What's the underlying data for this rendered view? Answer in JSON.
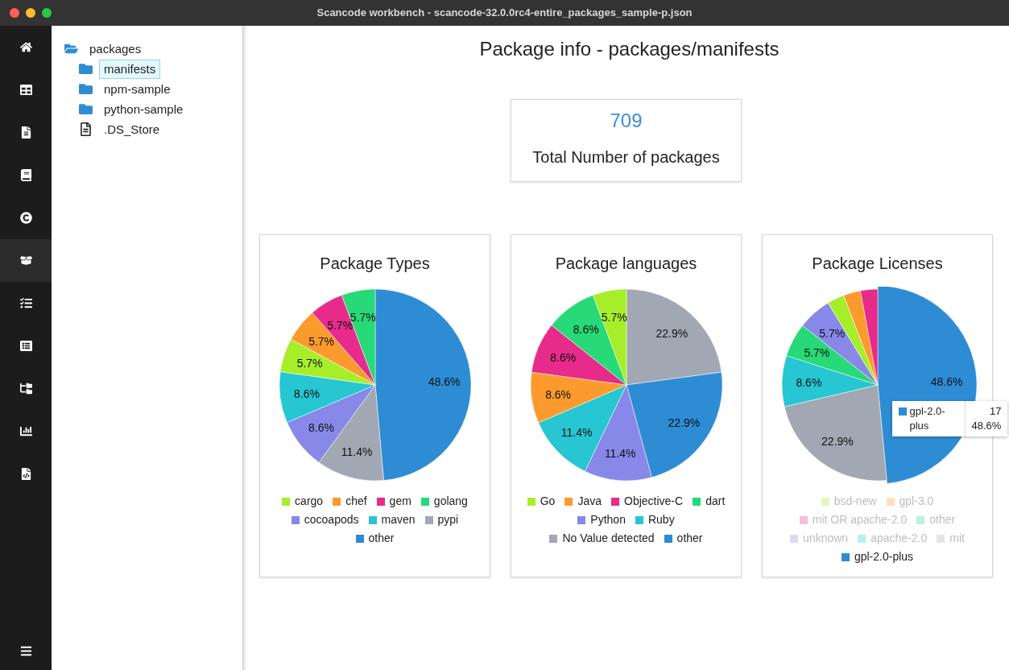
{
  "window": {
    "title": "Scancode workbench - scancode-32.0.0rc4-entire_packages_sample-p.json"
  },
  "sidebar": {
    "items": [
      {
        "selected": false
      },
      {
        "selected": false
      },
      {
        "selected": false
      },
      {
        "selected": false
      },
      {
        "selected": false
      },
      {
        "selected": true
      },
      {
        "selected": false
      },
      {
        "selected": false
      },
      {
        "selected": false
      },
      {
        "selected": false
      },
      {
        "selected": false
      }
    ]
  },
  "tree": [
    {
      "label": "packages",
      "kind": "folder",
      "expanded": true,
      "selected": false,
      "children": [
        {
          "label": "manifests",
          "kind": "folder",
          "selected": true
        },
        {
          "label": "npm-sample",
          "kind": "folder",
          "selected": false
        },
        {
          "label": "python-sample",
          "kind": "folder",
          "selected": false
        },
        {
          "label": ".DS_Store",
          "kind": "file",
          "selected": false
        }
      ]
    }
  ],
  "page": {
    "title": "Package info - packages/manifests"
  },
  "total": {
    "value": "709",
    "label": "Total Number of packages"
  },
  "charts": [
    {
      "chart_data": {
        "type": "pie",
        "title": "Package Types",
        "categories": [
          "cargo",
          "chef",
          "gem",
          "golang",
          "cocoapods",
          "maven",
          "pypi",
          "other"
        ],
        "values": [
          5.7,
          5.7,
          5.7,
          5.7,
          8.6,
          8.6,
          11.4,
          48.6
        ],
        "value_labels": [
          "5.7%",
          "5.7%",
          "5.7%",
          "5.7%",
          "8.6%",
          "8.6%",
          "11.4%",
          "48.6%"
        ],
        "colors": [
          "#a6ee2a",
          "#fd9a2d",
          "#e62b8a",
          "#27d977",
          "#8788e8",
          "#26c6d2",
          "#a1a8b3",
          "#2e8cd4"
        ]
      },
      "legend": [
        {
          "dimmed": false
        },
        {
          "dimmed": false
        },
        {
          "dimmed": false
        },
        {
          "dimmed": false
        },
        {
          "dimmed": false
        },
        {
          "dimmed": false
        },
        {
          "dimmed": false
        },
        {
          "dimmed": false
        }
      ]
    },
    {
      "chart_data": {
        "type": "pie",
        "title": "Package languages",
        "categories": [
          "Go",
          "Java",
          "Objective-C",
          "dart",
          "Python",
          "Ruby",
          "No Value detected",
          "other"
        ],
        "values": [
          5.7,
          8.6,
          8.6,
          8.6,
          11.4,
          11.4,
          22.9,
          22.9
        ],
        "value_labels": [
          "5.7%",
          "8.6%",
          "8.6%",
          "8.6%",
          "11.4%",
          "11.4%",
          "22.9%",
          "22.9%"
        ],
        "colors": [
          "#a6ee2a",
          "#fd9a2d",
          "#e62b8a",
          "#27d977",
          "#8788e8",
          "#26c6d2",
          "#a1a8b3",
          "#2e8cd4"
        ]
      },
      "legend": [
        {
          "dimmed": false
        },
        {
          "dimmed": false
        },
        {
          "dimmed": false
        },
        {
          "dimmed": false
        },
        {
          "dimmed": false
        },
        {
          "dimmed": false
        },
        {
          "dimmed": false
        },
        {
          "dimmed": false
        }
      ]
    },
    {
      "chart_data": {
        "type": "pie",
        "title": "Package Licenses",
        "categories": [
          "bsd-new",
          "gpl-3.0",
          "mit OR apache-2.0",
          "other",
          "unknown",
          "apache-2.0",
          "mit",
          "gpl-2.0-plus"
        ],
        "values": [
          2.9,
          2.9,
          2.9,
          5.7,
          5.7,
          8.6,
          22.9,
          48.6
        ],
        "value_labels": [
          null,
          null,
          null,
          "5.7%",
          "5.7%",
          "8.6%",
          "22.9%",
          "48.6%"
        ],
        "colors": [
          "#a6ee2a",
          "#fd9a2d",
          "#e62b8a",
          "#27d977",
          "#8788e8",
          "#26c6d2",
          "#a1a8b3",
          "#2e8cd4"
        ]
      },
      "legend": [
        {
          "dimmed": true
        },
        {
          "dimmed": true
        },
        {
          "dimmed": true
        },
        {
          "dimmed": true
        },
        {
          "dimmed": true
        },
        {
          "dimmed": true
        },
        {
          "dimmed": true
        },
        {
          "dimmed": false
        }
      ],
      "tooltip": {
        "name": "gpl-2.0-plus",
        "count": "17",
        "percent": "48.6%"
      }
    }
  ]
}
